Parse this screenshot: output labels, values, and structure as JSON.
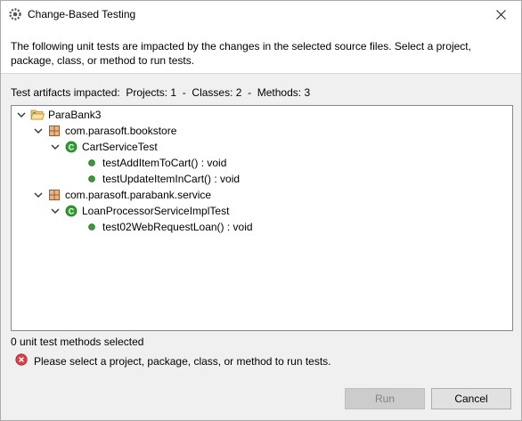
{
  "window": {
    "title": "Change-Based Testing"
  },
  "header": {
    "description": "The following unit tests are impacted by the changes in the selected source files. Select a project, package, class, or method to run tests."
  },
  "impacted_text": "Test artifacts impacted:  Projects: 1  -  Classes: 2  -  Methods: 3",
  "tree": {
    "project": "ParaBank3",
    "packages": [
      {
        "name": "com.parasoft.bookstore",
        "class": "CartServiceTest",
        "methods": [
          "testAddItemToCart() : void",
          "testUpdateItemInCart() : void"
        ]
      },
      {
        "name": "com.parasoft.parabank.service",
        "class": "LoanProcessorServiceImplTest",
        "methods": [
          "test02WebRequestLoan() : void"
        ]
      }
    ]
  },
  "status": {
    "selected_count": "0 unit test methods selected",
    "error": "Please select a project, package, class, or method to run tests."
  },
  "buttons": {
    "run": "Run",
    "cancel": "Cancel"
  },
  "colors": {
    "class_icon": "#2f9e2f",
    "method_dot": "#3a9a3a",
    "package_icon": "#c9875a",
    "error_icon": "#d9414b",
    "folder_icon": "#4a86c8"
  },
  "icons": {
    "app": "settings-gear-icon",
    "close": "close-icon",
    "project": "folder-open-icon",
    "package": "package-icon",
    "class": "class-c-icon",
    "method": "method-dot-icon",
    "error": "error-icon"
  }
}
